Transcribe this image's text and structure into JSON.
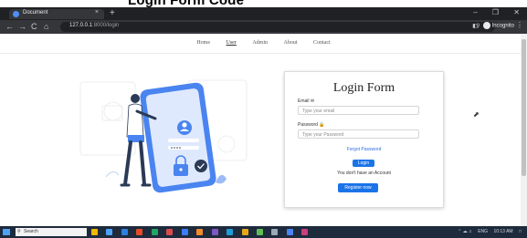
{
  "caption": "Login Form Code",
  "browser": {
    "tab_title": "Document",
    "tab_close": "×",
    "new_tab": "+",
    "url_host": "127.0.0.1",
    "url_path": ":8000/login",
    "incognito_label": "Incognito",
    "back": "←",
    "forward": "→",
    "reload": "C",
    "home": "⌂",
    "minimize": "–",
    "maximize": "❐",
    "close": "✕",
    "menu": "⋮",
    "zoom_icon": "⚲",
    "star_icon": "☆",
    "panel_icon": "◧"
  },
  "navbar": {
    "links": [
      "Home",
      "User",
      "Admin",
      "About",
      "Contact"
    ],
    "active": "User"
  },
  "login": {
    "title": "Login Form",
    "email_label": "Email",
    "email_placeholder": "Type your email",
    "password_label": "Password",
    "password_placeholder": "Type your Password",
    "forgot": "Forgot Password",
    "login_button": "Login",
    "no_account": "You don't have an Account",
    "register_button": "Register now"
  },
  "taskbar": {
    "search": "Search",
    "tray_lang": "ENG",
    "tray_time": "10:13 AM"
  },
  "colors": {
    "accent": "#1a73e8",
    "illustration_blue": "#4a84f0",
    "browser_dark": "#202124"
  }
}
